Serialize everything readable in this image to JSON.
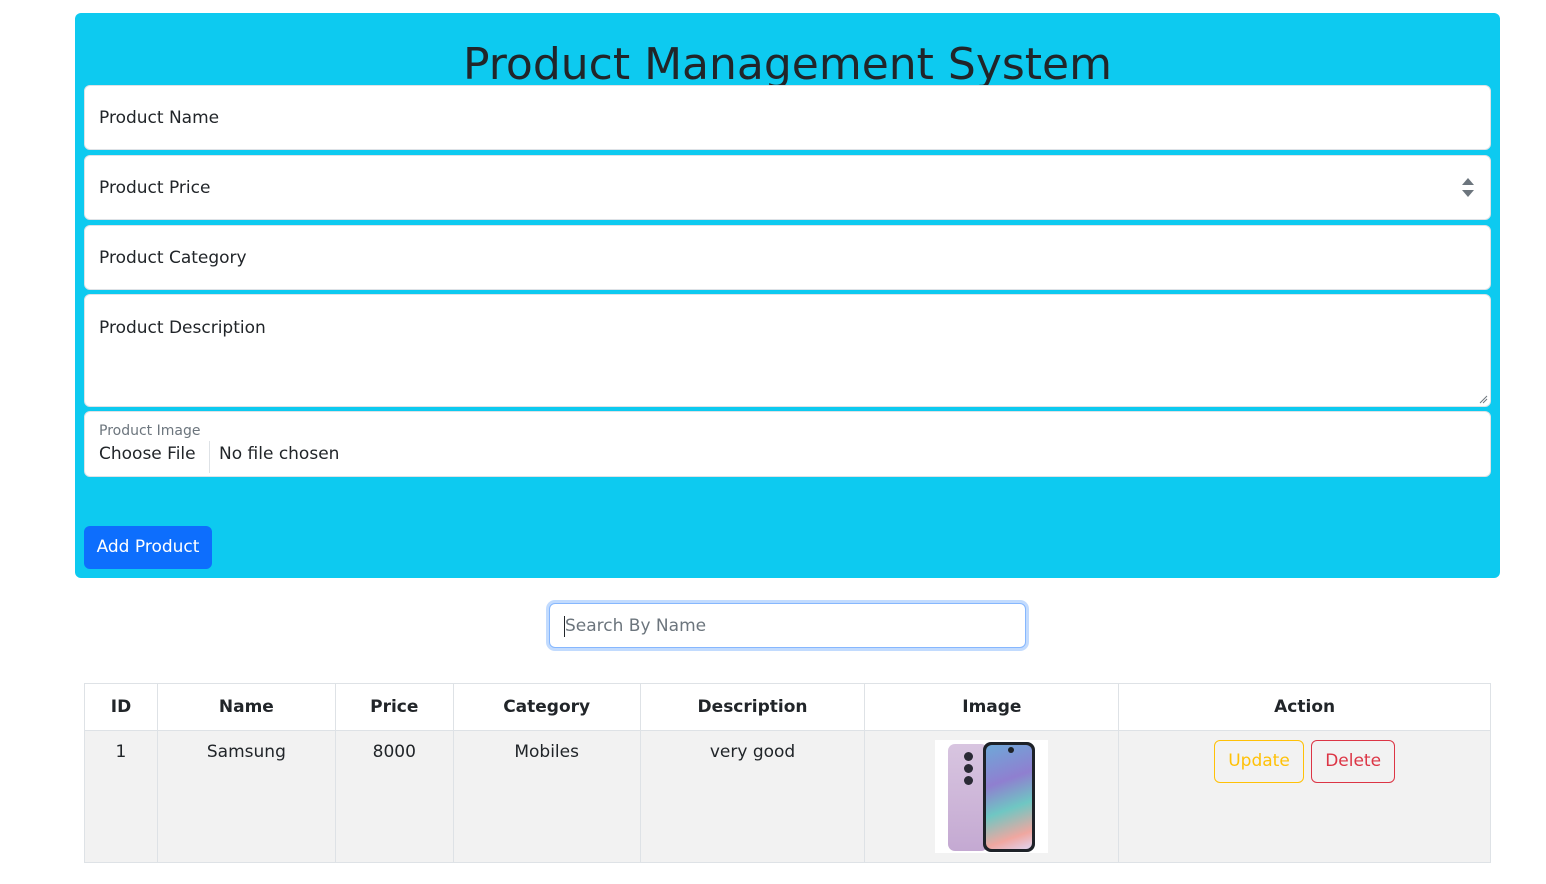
{
  "header": {
    "title": "Product Management System"
  },
  "form": {
    "name_placeholder": "Product Name",
    "price_placeholder": "Product Price",
    "category_placeholder": "Product Category",
    "description_placeholder": "Product Description",
    "image_label": "Product Image",
    "choose_file_label": "Choose File",
    "no_file_text": "No file chosen",
    "add_button_label": "Add Product"
  },
  "search": {
    "placeholder": "Search By Name"
  },
  "table": {
    "headers": [
      "ID",
      "Name",
      "Price",
      "Category",
      "Description",
      "Image",
      "Action"
    ],
    "rows": [
      {
        "id": "1",
        "name": "Samsung",
        "price": "8000",
        "category": "Mobiles",
        "description": "very good",
        "image_icon": "phone-image",
        "update_label": "Update",
        "delete_label": "Delete"
      }
    ]
  },
  "colors": {
    "panel": "#0dcaf0",
    "primary": "#0d6efd",
    "warning": "#ffc107",
    "danger": "#dc3545"
  }
}
